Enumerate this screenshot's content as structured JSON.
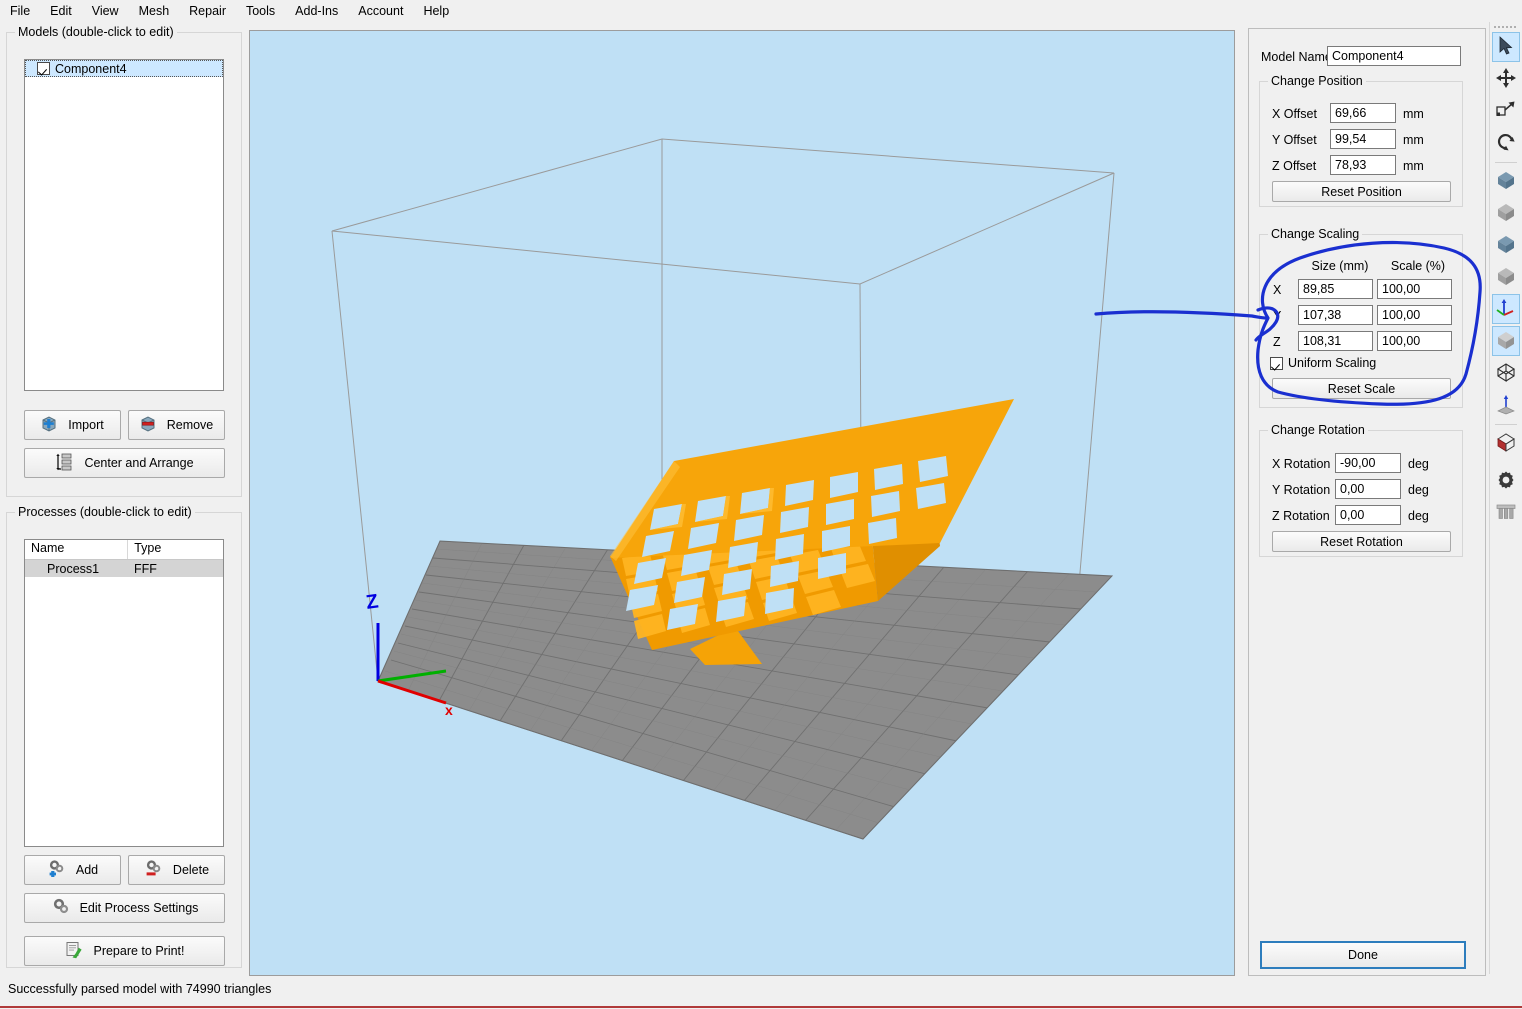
{
  "menubar": {
    "items": [
      {
        "label": "File"
      },
      {
        "label": "Edit"
      },
      {
        "label": "View"
      },
      {
        "label": "Mesh"
      },
      {
        "label": "Repair"
      },
      {
        "label": "Tools"
      },
      {
        "label": "Add-Ins"
      },
      {
        "label": "Account"
      },
      {
        "label": "Help"
      }
    ]
  },
  "models_panel": {
    "title": "Models (double-click to edit)",
    "items": [
      {
        "label": "Component4",
        "checked": true,
        "selected": true
      }
    ],
    "import_label": "Import",
    "remove_label": "Remove",
    "center_label": "Center and Arrange"
  },
  "processes_panel": {
    "title": "Processes (double-click to edit)",
    "columns": [
      "Name",
      "Type"
    ],
    "rows": [
      {
        "name": "Process1",
        "type": "FFF"
      }
    ],
    "add_label": "Add",
    "delete_label": "Delete",
    "edit_label": "Edit Process Settings",
    "prepare_label": "Prepare to Print!"
  },
  "viewport": {
    "background_color": "#bfe0f5",
    "plate_color": "#8c8c8c",
    "model_color": "#f5a306",
    "axis_labels": {
      "x": "x",
      "y": "",
      "z": "Z"
    },
    "axis_colors": {
      "x": "#e00000",
      "y": "#00b000",
      "z": "#0000e0"
    }
  },
  "right_panel": {
    "model_name_label": "Model Name:",
    "model_name_value": "Component4",
    "position": {
      "title": "Change Position",
      "fields": [
        {
          "label": "X Offset",
          "value": "69,66",
          "unit": "mm"
        },
        {
          "label": "Y Offset",
          "value": "99,54",
          "unit": "mm"
        },
        {
          "label": "Z Offset",
          "value": "78,93",
          "unit": "mm"
        }
      ],
      "reset_label": "Reset Position"
    },
    "scaling": {
      "title": "Change Scaling",
      "col_size": "Size (mm)",
      "col_scale": "Scale (%)",
      "rows": [
        {
          "axis": "X",
          "size": "89,85",
          "scale": "100,00"
        },
        {
          "axis": "Y",
          "size": "107,38",
          "scale": "100,00"
        },
        {
          "axis": "Z",
          "size": "108,31",
          "scale": "100,00"
        }
      ],
      "uniform_label": "Uniform Scaling",
      "uniform_checked": true,
      "reset_label": "Reset Scale"
    },
    "rotation": {
      "title": "Change Rotation",
      "fields": [
        {
          "label": "X Rotation",
          "value": "-90,00",
          "unit": "deg"
        },
        {
          "label": "Y Rotation",
          "value": "0,00",
          "unit": "deg"
        },
        {
          "label": "Z Rotation",
          "value": "0,00",
          "unit": "deg"
        }
      ],
      "reset_label": "Reset Rotation"
    },
    "done_label": "Done"
  },
  "toolbar": {
    "items": [
      {
        "icon": "cursor-select-icon",
        "active": true
      },
      {
        "icon": "move-arrows-icon",
        "active": false
      },
      {
        "icon": "scale-icon",
        "active": false
      },
      {
        "icon": "rotate-icon",
        "active": false
      },
      {
        "icon": "view-cube-front-icon",
        "active": false
      },
      {
        "icon": "view-cube-back-icon",
        "active": false
      },
      {
        "icon": "view-cube-left-icon",
        "active": false
      },
      {
        "icon": "view-cube-right-icon",
        "active": false
      },
      {
        "icon": "view-cube-axis-icon",
        "active": true
      },
      {
        "icon": "view-cube-top-icon",
        "active": true
      },
      {
        "icon": "wireframe-cube-icon",
        "active": false
      },
      {
        "icon": "place-surface-icon",
        "active": false
      },
      {
        "icon": "cross-section-icon",
        "active": false
      },
      {
        "icon": "gear-icon",
        "active": false
      },
      {
        "icon": "supports-icon",
        "active": false
      }
    ]
  },
  "statusbar": {
    "message": "Successfully parsed model with 74990 triangles"
  },
  "annotation": {
    "color": "#1a2fd0",
    "shape": "hand-drawn-ellipse-with-leader-line"
  }
}
